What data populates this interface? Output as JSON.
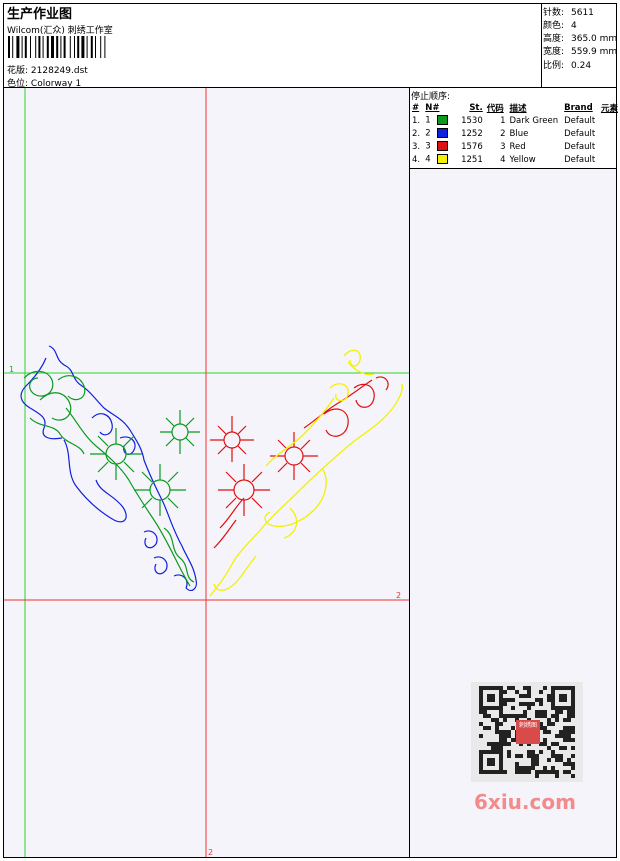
{
  "header": {
    "title": "生产作业图",
    "studio": "Wilcom(汇众) 刺绣工作室",
    "design_label": "花版:",
    "design_file": "2128249.dst",
    "colorway_label": "色位:",
    "colorway": "Colorway 1"
  },
  "stats": [
    {
      "label": "针数:",
      "value": "5611"
    },
    {
      "label": "颜色:",
      "value": "4"
    },
    {
      "label": "高度:",
      "value": "365.0 mm"
    },
    {
      "label": "宽度:",
      "value": "559.9 mm"
    },
    {
      "label": "比例:",
      "value": "0.24"
    }
  ],
  "stop_sequence": {
    "title": "停止顺序:",
    "columns": [
      "#",
      "N#",
      "St.",
      "代码",
      "描述",
      "Brand",
      "元素"
    ],
    "rows": [
      {
        "num": "1.",
        "n": "1",
        "color": "#0a9a1e",
        "st": "1530",
        "code": "1",
        "desc": "Dark Green",
        "brand": "Default"
      },
      {
        "num": "2.",
        "n": "2",
        "color": "#1020e0",
        "st": "1252",
        "code": "2",
        "desc": "Blue",
        "brand": "Default"
      },
      {
        "num": "3.",
        "n": "3",
        "color": "#e01010",
        "st": "1576",
        "code": "3",
        "desc": "Red",
        "brand": "Default"
      },
      {
        "num": "4.",
        "n": "4",
        "color": "#f2f200",
        "st": "1251",
        "code": "4",
        "desc": "Yellow",
        "brand": "Default"
      }
    ]
  },
  "guides": {
    "marker_1": "1",
    "marker_2": "2",
    "marker_3": "2"
  },
  "watermark": {
    "site": "6xiu.com",
    "seal": "刺绣图"
  }
}
